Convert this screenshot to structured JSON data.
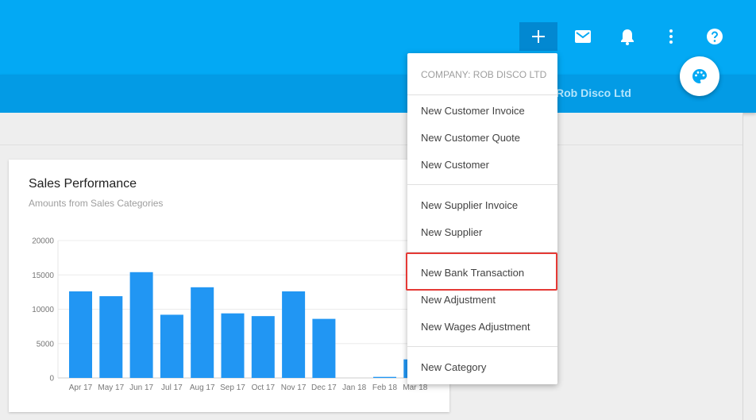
{
  "header": {
    "company_name": "Rob Disco Ltd",
    "toolbar": {
      "add": "plus-icon",
      "mail": "mail-icon",
      "notifications": "bell-icon",
      "more": "more-vert-icon",
      "help": "help-icon"
    },
    "fab_icon": "palette-icon"
  },
  "card": {
    "title": "Sales Performance",
    "subtitle": "Amounts from Sales Categories"
  },
  "chart_data": {
    "type": "bar",
    "categories": [
      "Apr 17",
      "May 17",
      "Jun 17",
      "Jul 17",
      "Aug 17",
      "Sep 17",
      "Oct 17",
      "Nov 17",
      "Dec 17",
      "Jan 18",
      "Feb 18",
      "Mar 18"
    ],
    "values": [
      12600,
      11900,
      15400,
      9200,
      13200,
      9400,
      9000,
      12600,
      8600,
      0,
      150,
      2700
    ],
    "ylim": [
      0,
      20000
    ],
    "yticks": [
      "20000",
      "15000",
      "10000",
      "5000",
      "0"
    ],
    "grid": true,
    "bar_color": "#2196f3"
  },
  "menu": {
    "header": "COMPANY: ROB DISCO LTD",
    "items": [
      "New Customer Invoice",
      "New Customer Quote",
      "New Customer",
      "New Supplier Invoice",
      "New Supplier",
      "New Bank Transaction",
      "New Adjustment",
      "New Wages Adjustment",
      "New Category"
    ],
    "highlighted": "New Bank Transaction"
  },
  "colors": {
    "primary": "#03a9f4",
    "primary_dark": "#039be5",
    "highlight": "#e53935"
  }
}
